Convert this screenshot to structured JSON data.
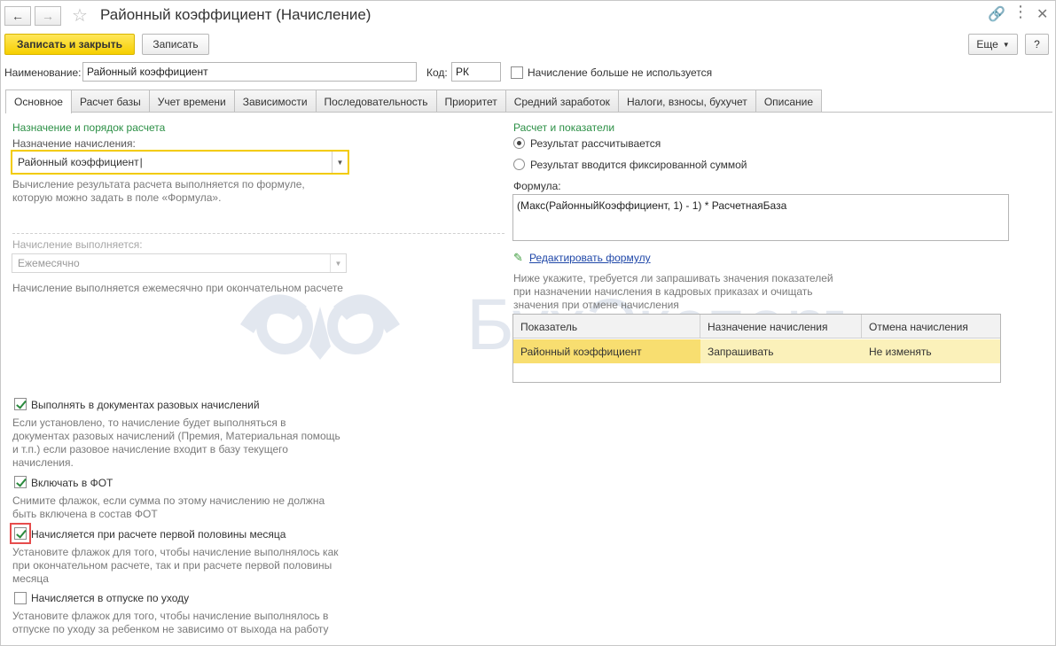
{
  "window": {
    "title": "Районный коэффициент (Начисление)",
    "more_label": "Еще",
    "help_label": "?"
  },
  "toolbar": {
    "save_close_label": "Записать и закрыть",
    "save_label": "Записать"
  },
  "header": {
    "name_label": "Наименование:",
    "name_value": "Районный коэффициент",
    "code_label": "Код:",
    "code_value": "РК",
    "not_used_label": "Начисление больше не используется"
  },
  "tabs": [
    {
      "label": "Основное"
    },
    {
      "label": "Расчет базы"
    },
    {
      "label": "Учет времени"
    },
    {
      "label": "Зависимости"
    },
    {
      "label": "Последовательность"
    },
    {
      "label": "Приоритет"
    },
    {
      "label": "Средний заработок"
    },
    {
      "label": "Налоги, взносы, бухучет"
    },
    {
      "label": "Описание"
    }
  ],
  "left": {
    "section_title": "Назначение и порядок расчета",
    "purpose_label": "Назначение начисления:",
    "purpose_value": "Районный коэффициент",
    "purpose_hint_1": "Вычисление результата расчета выполняется по формуле,",
    "purpose_hint_2": "которую можно задать в поле «Формула».",
    "period_label": "Начисление выполняется:",
    "period_value": "Ежемесячно",
    "period_hint": "Начисление выполняется ежемесячно при окончательном расчете",
    "one_time_label": "Выполнять в документах разовых начислений",
    "one_time_hint_1": "Если установлено, то начисление будет выполняться в",
    "one_time_hint_2": "документах разовых начислений (Премия, Материальная помощь",
    "one_time_hint_3": "и т.п.) если разовое начисление входит в базу текущего",
    "one_time_hint_4": "начисления.",
    "fot_label": "Включать в ФОТ",
    "fot_hint_1": "Снимите флажок, если сумма по этому начислению не должна",
    "fot_hint_2": "быть включена в состав ФОТ",
    "first_half_label": "Начисляется при расчете первой половины месяца",
    "first_half_hint_1": "Установите флажок для того, чтобы начисление выполнялось как",
    "first_half_hint_2": "при окончательном расчете, так и при расчете первой половины",
    "first_half_hint_3": "месяца",
    "vacation_label": "Начисляется в отпуске по уходу",
    "vacation_hint_1": "Установите флажок для того, чтобы начисление выполнялось в",
    "vacation_hint_2": "отпуске по уходу за ребенком не зависимо от выхода на работу"
  },
  "right": {
    "section_title": "Расчет и показатели",
    "radio_calc": "Результат рассчитывается",
    "radio_fixed": "Результат вводится фиксированной суммой",
    "formula_label": "Формула:",
    "formula_value": "(Макс(РайонныйКоэффициент, 1) - 1) * РасчетнаяБаза",
    "edit_formula": "Редактировать формулу",
    "indicators_hint_1": "Ниже укажите, требуется ли запрашивать значения показателей",
    "indicators_hint_2": "при назначении начисления в кадровых приказах и очищать",
    "indicators_hint_3": "значения при отмене начисления",
    "table": {
      "columns": [
        "Показатель",
        "Назначение начисления",
        "Отмена начисления"
      ],
      "rows": [
        [
          "Районный коэффициент",
          "Запрашивать",
          "Не изменять"
        ]
      ]
    }
  },
  "watermark_text": "БухЭксперт"
}
